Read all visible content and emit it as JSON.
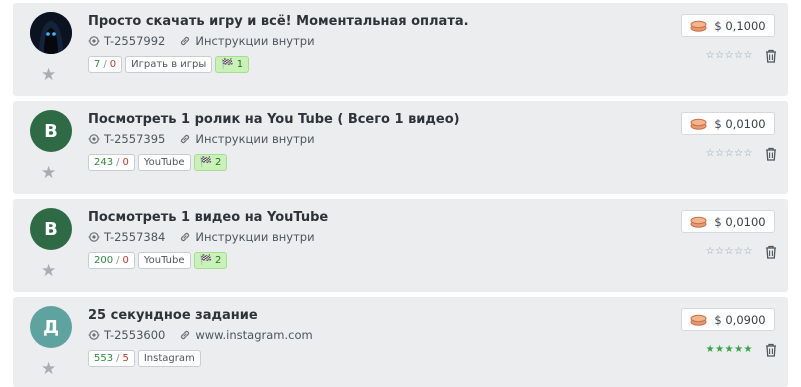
{
  "tasks": [
    {
      "title": "Просто скачать игру и всё! Моментальная оплата.",
      "id": "T-2557992",
      "link_text": "Инструкции внутри",
      "counts": {
        "done": "7",
        "rejected": "0"
      },
      "tag": "Играть в игры",
      "flag_count": "1",
      "price": "$ 0,1000",
      "rating": "☆☆☆☆☆",
      "avatar": {
        "type": "image",
        "icon": "hooded-figure-icon"
      }
    },
    {
      "title": "Посмотреть 1 ролик на You Tube ( Всего 1 видео)",
      "id": "T-2557395",
      "link_text": "Инструкции внутри",
      "counts": {
        "done": "243",
        "rejected": "0"
      },
      "tag": "YouTube",
      "flag_count": "2",
      "price": "$ 0,0100",
      "rating": "☆☆☆☆☆",
      "avatar": {
        "type": "letter",
        "letter": "В",
        "color": "#2e6b45"
      }
    },
    {
      "title": "Посмотреть 1 видео на YouTube",
      "id": "T-2557384",
      "link_text": "Инструкции внутри",
      "counts": {
        "done": "200",
        "rejected": "0"
      },
      "tag": "YouTube",
      "flag_count": "2",
      "price": "$ 0,0100",
      "rating": "☆☆☆☆☆",
      "avatar": {
        "type": "letter",
        "letter": "В",
        "color": "#2e6b45"
      }
    },
    {
      "title": "25 секундное задание",
      "id": "T-2553600",
      "link_text": "www.instagram.com",
      "counts": {
        "done": "553",
        "rejected": "5"
      },
      "tag": "Instagram",
      "price": "$ 0,0900",
      "rating": "★★★★★",
      "avatar": {
        "type": "letter",
        "letter": "Д",
        "color": "#5fa3a0"
      }
    }
  ]
}
